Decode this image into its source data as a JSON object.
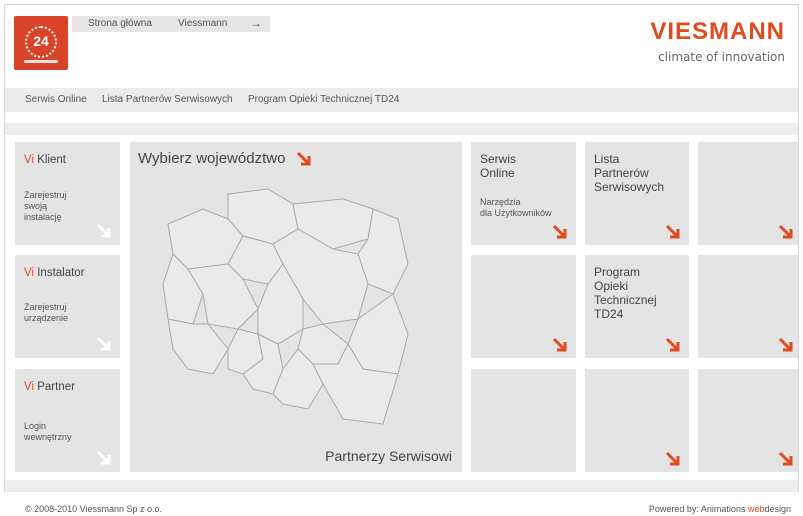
{
  "logo": {
    "number": "24"
  },
  "topnav": {
    "home": "Strona główna",
    "viessmann": "Viessmann",
    "arrow": "→"
  },
  "brand": {
    "name": "VIESMANN",
    "tagline": "climate of innovation"
  },
  "menu": [
    "Serwis Online",
    "Lista Partnerów Serwisowych",
    "Program Opieki Technicznej TD24"
  ],
  "tiles": {
    "klient": {
      "vi": "Vi",
      "title": " Klient",
      "sub": "Zarejestruj\nswoją\ninstalację"
    },
    "instalator": {
      "vi": "Vi",
      "title": " Instalator",
      "sub": "Zarejestruj\nurządzenie"
    },
    "partner": {
      "vi": "Vi",
      "title": " Partner",
      "sub": "Login\nwewnętrzny"
    },
    "map": {
      "head": "Wybierz województwo",
      "partners": "Partnerzy Serwisowi"
    },
    "serwis": {
      "title": "Serwis\nOnline",
      "sub": "Narzędzia\ndla Użytkowników"
    },
    "lista": {
      "title": "Lista\nPartnerów\nSerwisowych"
    },
    "program": {
      "title": "Program\nOpieki\nTechnicznej\nTD24"
    }
  },
  "footer": {
    "copyright": "© 2008-2010 Viessmann Sp z o.o.",
    "powered": "Powered by: Animations ",
    "web": "web",
    "design": "design"
  },
  "colors": {
    "accent": "#e24a1e",
    "tile": "#e4e4e4",
    "arrow_white": "#ffffff"
  }
}
